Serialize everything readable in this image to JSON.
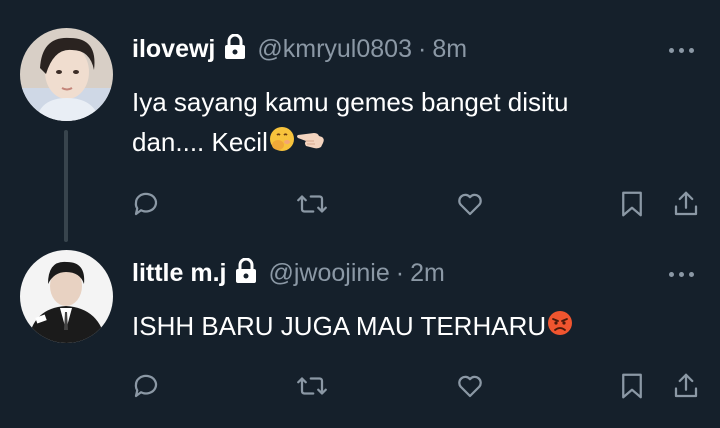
{
  "tweets": [
    {
      "display_name": "ilovewj",
      "handle": "@kmryul0803",
      "separator": "·",
      "time": "8m",
      "text_line1": "Iya sayang kamu gemes banget disitu",
      "text_line2": "dan.... Kecil",
      "emojis": [
        "face-with-hand-over-mouth-emoji",
        "backhand-index-pointing-left-emoji"
      ],
      "protected": true
    },
    {
      "display_name": "little m.j",
      "handle": "@jwoojinie",
      "separator": "·",
      "time": "2m",
      "text_line1": "ISHH BARU JUGA MAU TERHARU",
      "emojis": [
        "angry-face-emoji"
      ],
      "protected": true
    }
  ],
  "colors": {
    "background": "#15202b",
    "text": "#ffffff",
    "muted": "#8b98a5",
    "thread_line": "#38444d"
  },
  "icons": [
    "reply-icon",
    "retweet-icon",
    "like-icon",
    "bookmark-icon",
    "share-icon",
    "more-icon",
    "lock-icon"
  ]
}
